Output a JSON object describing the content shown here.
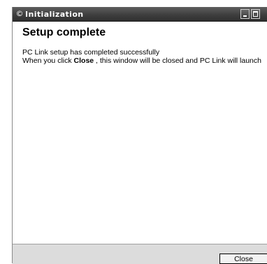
{
  "window": {
    "title": "Initialization",
    "icon": "app-icon"
  },
  "titlebar_buttons": {
    "minimize_icon": "minimize-icon",
    "maximize_icon": "maximize-icon"
  },
  "content": {
    "heading": "Setup complete",
    "line1": "PC Link setup has completed successfully",
    "line2_prefix": "When you click ",
    "line2_bold": "Close",
    "line2_suffix": " , this window will be closed and PC Link will launch"
  },
  "footer": {
    "close_label": "Close"
  }
}
